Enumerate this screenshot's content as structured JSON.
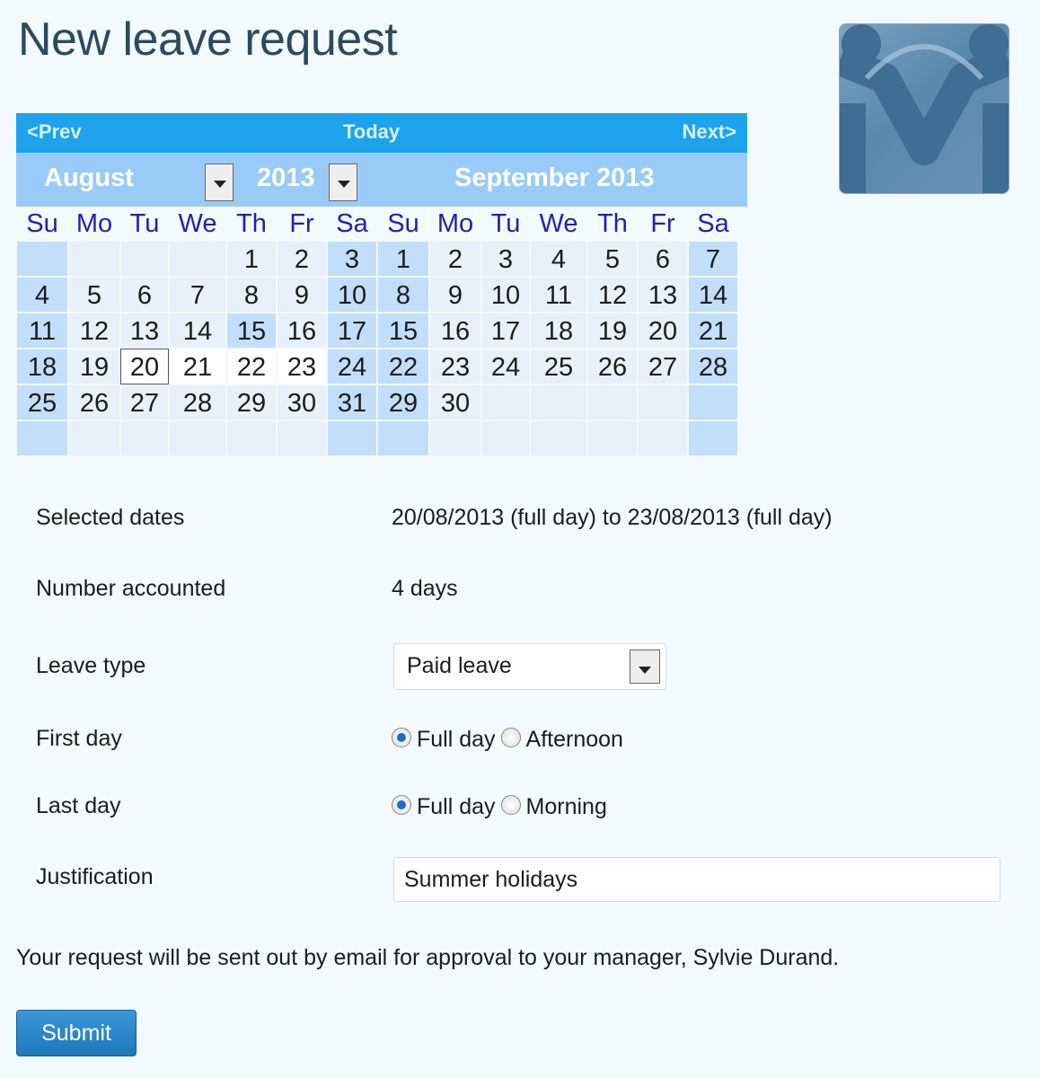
{
  "page": {
    "title": "New leave request"
  },
  "calendar": {
    "nav": {
      "prev": "<Prev",
      "today": "Today",
      "next": "Next>"
    },
    "month_select": "August",
    "year_select": "2013",
    "second_month_title": "September 2013",
    "weekdays": [
      "Su",
      "Mo",
      "Tu",
      "We",
      "Th",
      "Fr",
      "Sa",
      "Su",
      "Mo",
      "Tu",
      "We",
      "Th",
      "Fr",
      "Sa"
    ],
    "rows": [
      [
        "",
        "",
        "",
        "",
        "1",
        "2",
        "3",
        "1",
        "2",
        "3",
        "4",
        "5",
        "6",
        "7"
      ],
      [
        "4",
        "5",
        "6",
        "7",
        "8",
        "9",
        "10",
        "8",
        "9",
        "10",
        "11",
        "12",
        "13",
        "14"
      ],
      [
        "11",
        "12",
        "13",
        "14",
        "15",
        "16",
        "17",
        "15",
        "16",
        "17",
        "18",
        "19",
        "20",
        "21"
      ],
      [
        "18",
        "19",
        "20",
        "21",
        "22",
        "23",
        "24",
        "22",
        "23",
        "24",
        "25",
        "26",
        "27",
        "28"
      ],
      [
        "25",
        "26",
        "27",
        "28",
        "29",
        "30",
        "31",
        "29",
        "30",
        "",
        "",
        "",
        "",
        ""
      ],
      [
        "",
        "",
        "",
        "",
        "",
        "",
        "",
        "",
        "",
        "",
        "",
        "",
        "",
        ""
      ]
    ]
  },
  "form": {
    "selected_dates": {
      "label": "Selected dates",
      "value": "20/08/2013 (full day) to 23/08/2013 (full day)"
    },
    "number_accounted": {
      "label": "Number accounted",
      "value": "4 days"
    },
    "leave_type": {
      "label": "Leave type",
      "value": "Paid leave"
    },
    "first_day": {
      "label": "First day",
      "options": [
        "Full day",
        "Afternoon"
      ],
      "selected": "Full day"
    },
    "last_day": {
      "label": "Last day",
      "options": [
        "Full day",
        "Morning"
      ],
      "selected": "Full day"
    },
    "justification": {
      "label": "Justification",
      "value": "Summer holidays"
    }
  },
  "notice": "Your request will be sent out by email for approval to your manager, Sylvie Durand.",
  "submit_label": "Submit",
  "colors": {
    "nav_bar": "#1ca3ec",
    "header_bar": "#9acbf7",
    "weekday_text": "#2222aa",
    "weekend_cell": "#c2defb",
    "weekday_cell": "#e6f1fb",
    "button": "#2a88c8"
  }
}
